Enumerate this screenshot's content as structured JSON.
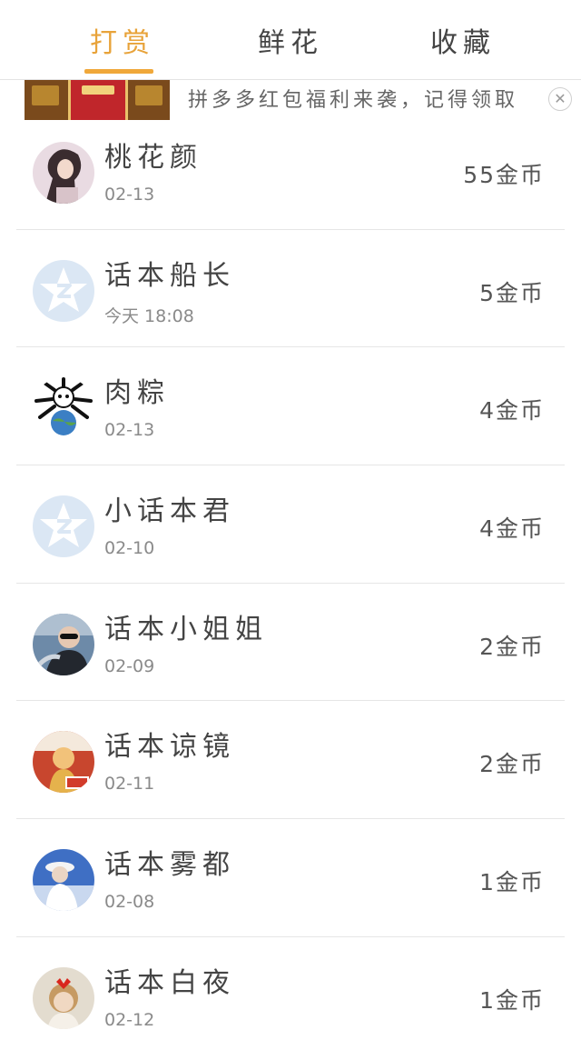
{
  "tabs": [
    {
      "label": "打赏",
      "active": true
    },
    {
      "label": "鲜花",
      "active": false
    },
    {
      "label": "收藏",
      "active": false
    }
  ],
  "ad": {
    "text": "拼多多红包福利来袭，记得领取",
    "close_icon": "close-icon"
  },
  "colors": {
    "accent": "#e8a33a",
    "divider": "#e6e6e6",
    "default_avatar": "#dbe7f4"
  },
  "rewards": [
    {
      "name": "桃花颜",
      "date": "02-13",
      "amount": "55金币",
      "avatar": "photo-avatar-icon"
    },
    {
      "name": "话本船长",
      "date": "今天 18:08",
      "amount": "5金币",
      "avatar": "default-star-avatar-icon"
    },
    {
      "name": "肉粽",
      "date": "02-13",
      "amount": "4金币",
      "avatar": "globe-avatar-icon"
    },
    {
      "name": "小话本君",
      "date": "02-10",
      "amount": "4金币",
      "avatar": "default-star-avatar-icon"
    },
    {
      "name": "话本小姐姐",
      "date": "02-09",
      "amount": "2金币",
      "avatar": "photo-avatar-icon"
    },
    {
      "name": "话本谅镜",
      "date": "02-11",
      "amount": "2金币",
      "avatar": "photo-avatar-icon"
    },
    {
      "name": "话本雾都",
      "date": "02-08",
      "amount": "1金币",
      "avatar": "photo-avatar-icon"
    },
    {
      "name": "话本白夜",
      "date": "02-12",
      "amount": "1金币",
      "avatar": "photo-avatar-icon"
    }
  ]
}
